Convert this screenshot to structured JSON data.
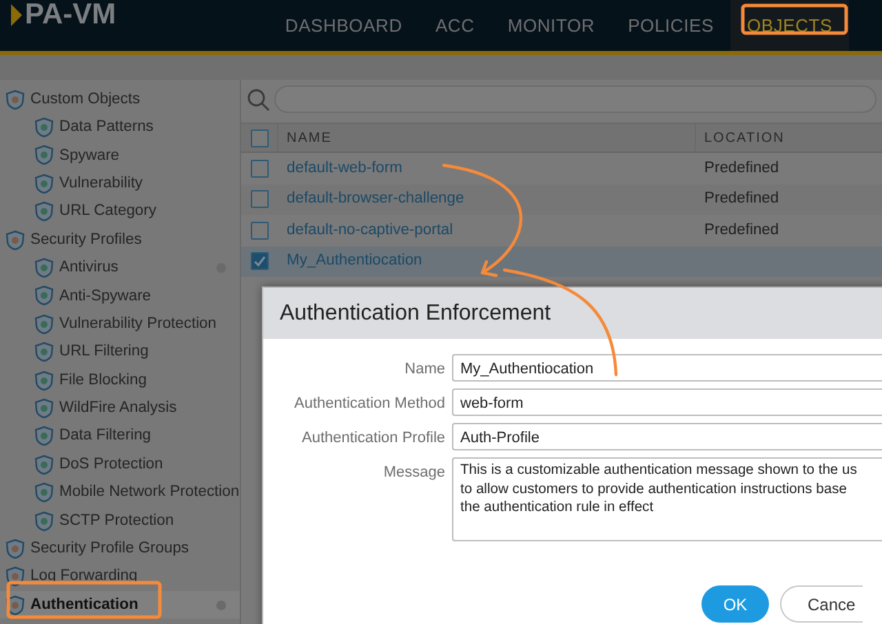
{
  "app": {
    "logo": "PA-VM"
  },
  "nav": [
    {
      "label": "DASHBOARD",
      "selected": false
    },
    {
      "label": "ACC",
      "selected": false
    },
    {
      "label": "MONITOR",
      "selected": false
    },
    {
      "label": "POLICIES",
      "selected": false
    },
    {
      "label": "OBJECTS",
      "selected": true
    }
  ],
  "sidebar": {
    "items": [
      {
        "label": "Custom Objects",
        "selected": false,
        "marked": false,
        "children": [
          {
            "label": "Data Patterns",
            "selected": false,
            "marked": false
          },
          {
            "label": "Spyware",
            "selected": false,
            "marked": false
          },
          {
            "label": "Vulnerability",
            "selected": false,
            "marked": false
          },
          {
            "label": "URL Category",
            "selected": false,
            "marked": false
          }
        ]
      },
      {
        "label": "Security Profiles",
        "selected": false,
        "marked": false,
        "children": [
          {
            "label": "Antivirus",
            "selected": false,
            "marked": true
          },
          {
            "label": "Anti-Spyware",
            "selected": false,
            "marked": false
          },
          {
            "label": "Vulnerability Protection",
            "selected": false,
            "marked": false
          },
          {
            "label": "URL Filtering",
            "selected": false,
            "marked": false
          },
          {
            "label": "File Blocking",
            "selected": false,
            "marked": false
          },
          {
            "label": "WildFire Analysis",
            "selected": false,
            "marked": false
          },
          {
            "label": "Data Filtering",
            "selected": false,
            "marked": false
          },
          {
            "label": "DoS Protection",
            "selected": false,
            "marked": false
          },
          {
            "label": "Mobile Network Protection",
            "selected": false,
            "marked": false
          },
          {
            "label": "SCTP Protection",
            "selected": false,
            "marked": false
          }
        ]
      },
      {
        "label": "Security Profile Groups",
        "selected": false,
        "marked": false
      },
      {
        "label": "Log Forwarding",
        "selected": false,
        "marked": false
      },
      {
        "label": "Authentication",
        "selected": true,
        "marked": true
      }
    ]
  },
  "table": {
    "all_checked": false,
    "columns": [
      "NAME",
      "LOCATION"
    ],
    "rows": [
      {
        "name": "default-web-form",
        "location": "Predefined",
        "checked": false
      },
      {
        "name": "default-browser-challenge",
        "location": "Predefined",
        "checked": false
      },
      {
        "name": "default-no-captive-portal",
        "location": "Predefined",
        "checked": false
      },
      {
        "name": "My_Authentiocation",
        "checked": true
      }
    ]
  },
  "dialog": {
    "title": "Authentication Enforcement",
    "fields": [
      {
        "label": "Name",
        "value": "My_Authentiocation",
        "kind": "text"
      },
      {
        "label": "Authentication Method",
        "value": "web-form",
        "kind": "text"
      },
      {
        "label": "Authentication Profile",
        "value": "Auth-Profile",
        "kind": "text"
      },
      {
        "label": "Message",
        "value": "This is a customizable authentication message shown to the us\nto allow customers to provide authentication instructions base\nthe authentication rule in effect",
        "kind": "textarea"
      }
    ],
    "buttons": [
      {
        "label": "OK",
        "kind": "primary"
      },
      {
        "label": "Cance",
        "kind": "secondary"
      }
    ]
  }
}
